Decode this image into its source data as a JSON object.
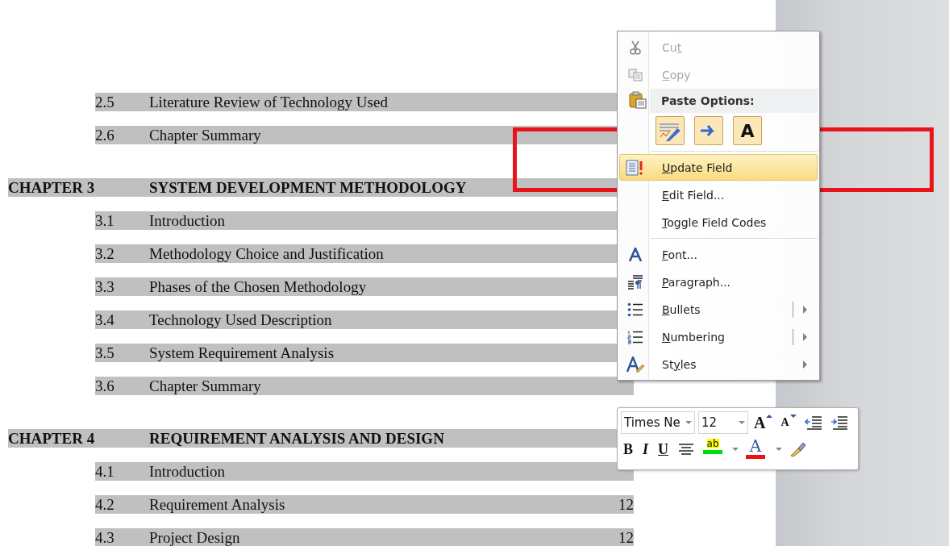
{
  "document": {
    "toc": [
      {
        "kind": "section",
        "number": "2.5",
        "title": "Literature Review of Technology Used"
      },
      {
        "kind": "section",
        "number": "2.6",
        "title": "Chapter Summary"
      },
      {
        "kind": "chapter",
        "number": "CHAPTER 3",
        "title": "SYSTEM DEVELOPMENT METHODOLOGY"
      },
      {
        "kind": "section",
        "number": "3.1",
        "title": "Introduction"
      },
      {
        "kind": "section",
        "number": "3.2",
        "title": "Methodology Choice and Justification"
      },
      {
        "kind": "section",
        "number": "3.3",
        "title": "Phases of the Chosen Methodology"
      },
      {
        "kind": "section",
        "number": "3.4",
        "title": "Technology Used Description"
      },
      {
        "kind": "section",
        "number": "3.5",
        "title": "System Requirement Analysis"
      },
      {
        "kind": "section",
        "number": "3.6",
        "title": "Chapter Summary"
      },
      {
        "kind": "chapter",
        "number": "CHAPTER 4",
        "title": "REQUIREMENT ANALYSIS AND DESIGN"
      },
      {
        "kind": "section",
        "number": "4.1",
        "title": "Introduction"
      },
      {
        "kind": "section",
        "number": "4.2",
        "title": "Requirement Analysis",
        "page": "12"
      },
      {
        "kind": "section",
        "number": "4.3",
        "title": "Project Design",
        "page": "12"
      }
    ]
  },
  "context_menu": {
    "items": [
      {
        "kind": "item",
        "label": {
          "before": "Cu",
          "key": "t"
        },
        "disabled": true,
        "selected": false
      },
      {
        "kind": "item",
        "label": {
          "key": "C",
          "after": "opy"
        },
        "disabled": true,
        "selected": false
      },
      {
        "kind": "header",
        "label": "Paste Options:"
      },
      {
        "kind": "paste_row",
        "glyph": "A"
      },
      {
        "kind": "separator"
      },
      {
        "kind": "item",
        "label": {
          "key": "U",
          "after": "pdate Field"
        },
        "disabled": false,
        "selected": true
      },
      {
        "kind": "item",
        "label": {
          "key": "E",
          "after": "dit Field..."
        },
        "disabled": false,
        "selected": false
      },
      {
        "kind": "item",
        "label": {
          "key": "T",
          "after": "oggle Field Codes"
        },
        "disabled": false,
        "selected": false
      },
      {
        "kind": "separator"
      },
      {
        "kind": "item",
        "label": {
          "key": "F",
          "after": "ont..."
        },
        "disabled": false,
        "selected": false
      },
      {
        "kind": "item",
        "label": {
          "key": "P",
          "after": "aragraph..."
        },
        "disabled": false,
        "selected": false
      },
      {
        "kind": "item",
        "label": {
          "key": "B",
          "after": "ullets"
        },
        "disabled": false,
        "selected": false,
        "submenu": true,
        "split": true
      },
      {
        "kind": "item",
        "label": {
          "key": "N",
          "after": "umbering"
        },
        "disabled": false,
        "selected": false,
        "submenu": true,
        "split": true
      },
      {
        "kind": "item",
        "label": {
          "before": "St",
          "key": "y",
          "after": "les"
        },
        "disabled": false,
        "selected": false,
        "submenu": true,
        "split": false
      }
    ]
  },
  "mini_toolbar": {
    "font": "Times Ne",
    "size": "12",
    "grow_glyph": "A",
    "shrink_glyph": "A",
    "bold": "B",
    "italic": "I",
    "underline": "U",
    "highlight_glyph": "ab",
    "font_color_glyph": "A"
  }
}
